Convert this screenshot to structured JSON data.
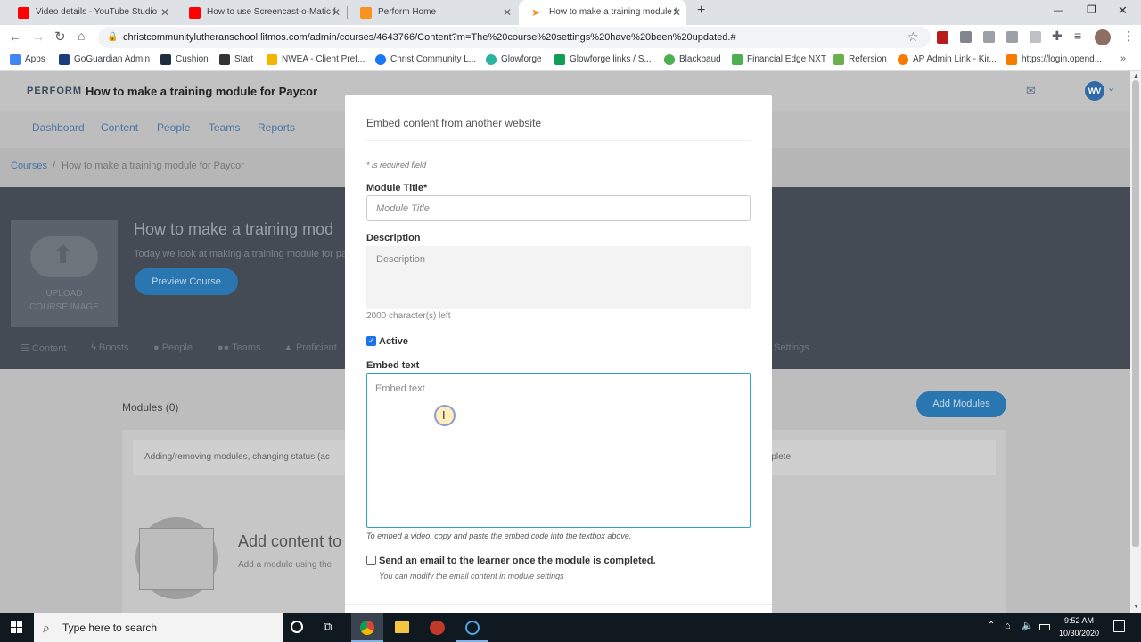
{
  "browser": {
    "tabs": [
      {
        "title": "Video details - YouTube Studio",
        "icon_color": "#ff0000"
      },
      {
        "title": "How to use Screencast-o-Matic f",
        "icon_color": "#ff0000"
      },
      {
        "title": "Perform Home",
        "icon_color": "#f7931e"
      },
      {
        "title": "How to make a training module f",
        "icon_color": "#f7931e",
        "active": true
      }
    ],
    "new_tab": "+",
    "url": "christcommunitylutheranschool.litmos.com/admin/courses/4643766/Content?m=The%20course%20settings%20have%20been%20updated.#",
    "bookmarks": [
      {
        "label": "Apps",
        "color": "#4285f4"
      },
      {
        "label": "GoGuardian Admin",
        "color": "#1a3d7c"
      },
      {
        "label": "Cushion",
        "color": "#1f2d3d"
      },
      {
        "label": "Start",
        "color": "#333333"
      },
      {
        "label": "NWEA - Client Pref...",
        "color": "#f4b400"
      },
      {
        "label": "Christ Community L...",
        "color": "#1877f2"
      },
      {
        "label": "Glowforge",
        "color": "#2bb3a0"
      },
      {
        "label": "Glowforge links / S...",
        "color": "#0f9d58"
      },
      {
        "label": "Blackbaud",
        "color": "#4caf50"
      },
      {
        "label": "Financial Edge NXT",
        "color": "#4caf50"
      },
      {
        "label": "Refersion",
        "color": "#6ab04c"
      },
      {
        "label": "AP Admin Link - Kir...",
        "color": "#f57c00"
      },
      {
        "label": "https://login.opend...",
        "color": "#f57c00"
      }
    ]
  },
  "app": {
    "logo": "PERFORM",
    "course_title": "How to make a training module for Paycor",
    "avatar_initials": "WV",
    "nav": [
      "Dashboard",
      "Content",
      "People",
      "Teams",
      "Reports"
    ],
    "breadcrumb": [
      "Courses",
      "How to make a training module for Paycor"
    ],
    "hero_title": "How to make a training mod",
    "hero_sub": "Today we look at making a training module for pa",
    "upload_label": "UPLOAD\nCOURSE IMAGE",
    "preview_button": "Preview Course",
    "course_tabs": [
      "Content",
      "Boosts",
      "People",
      "Teams",
      "Proficient",
      "Settings"
    ],
    "modules_label": "Modules (0)",
    "add_modules_button": "Add Modules",
    "info_banner_left": "Adding/removing modules, changing status (ac",
    "info_banner_right": "mplete.",
    "add_content_title": "Add content to",
    "add_content_sub": "Add a module using the"
  },
  "modal": {
    "title": "Embed content from another website",
    "required_note": "* is required field",
    "module_title_label": "Module Title*",
    "module_title_placeholder": "Module Title",
    "description_label": "Description",
    "description_placeholder": "Description",
    "char_left": "2000 character(s) left",
    "active_label": "Active",
    "active_checked": true,
    "embed_label": "Embed text",
    "embed_placeholder": "Embed text",
    "embed_hint": "To embed a video, copy and paste the embed code into the textbox above.",
    "email_label": "Send an email to the learner once the module is completed.",
    "email_checked": false,
    "email_hint": "You can modify the email content in module settings"
  },
  "taskbar": {
    "search_placeholder": "Type here to search",
    "time": "9:52 AM",
    "date": "10/30/2020"
  }
}
